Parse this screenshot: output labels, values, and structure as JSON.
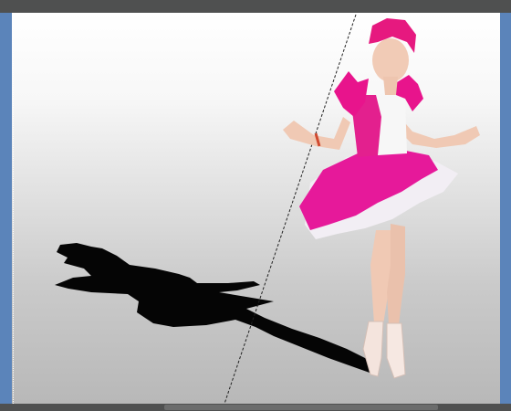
{
  "window": {
    "accent_color": "#5b84ba",
    "chrome_color": "#4f5050"
  },
  "canvas": {
    "content": "photo-composite",
    "selection_tool": "polygonal-lasso",
    "horizontal_scroll_position": 0.56
  },
  "icons": [
    "selection-marquee"
  ]
}
